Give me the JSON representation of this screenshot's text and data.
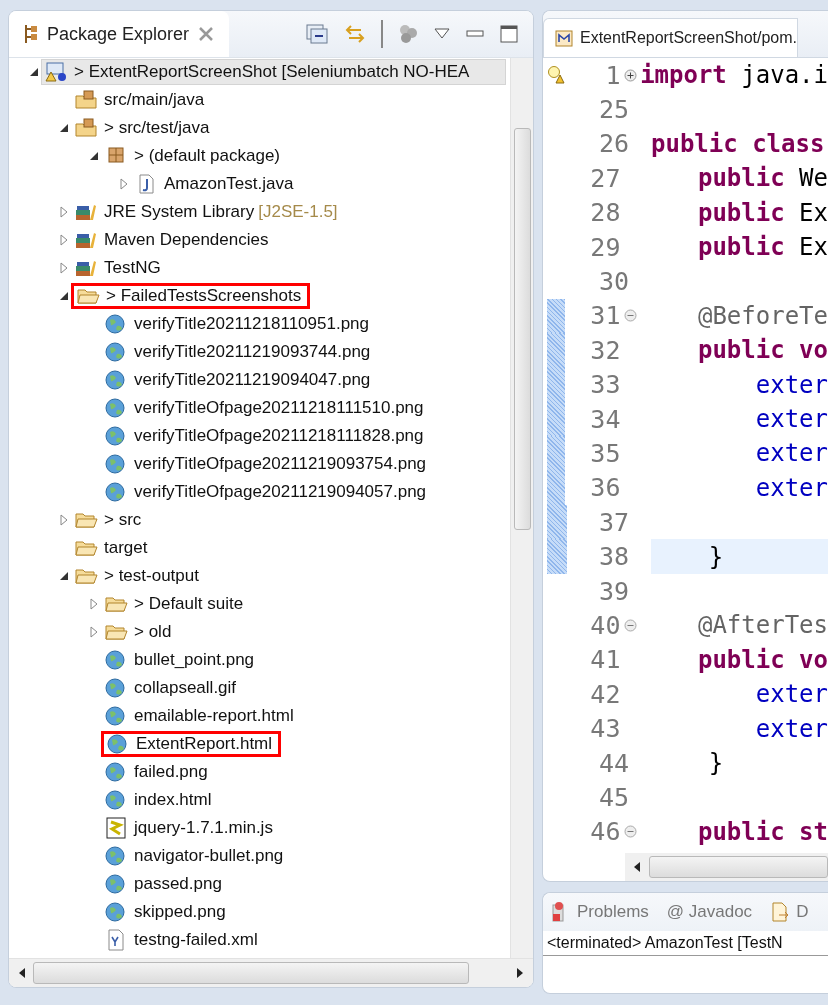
{
  "explorer": {
    "title": "Package Explorer",
    "tree": [
      {
        "kind": "project",
        "label": "> ExtentReportScreenShot [Seleniumbatch NO-HEA",
        "selected": true,
        "highlighted": false,
        "expanded": true,
        "children": [
          {
            "kind": "source-folder",
            "label": "src/main/java",
            "selected": false,
            "highlighted": false
          },
          {
            "kind": "source-folder",
            "label": "> src/test/java",
            "selected": false,
            "highlighted": false,
            "expanded": true,
            "children": [
              {
                "kind": "package",
                "label": "> (default package)",
                "selected": false,
                "highlighted": false,
                "expanded": true,
                "children": [
                  {
                    "kind": "java-file",
                    "label": "AmazonTest.java",
                    "selected": false,
                    "highlighted": false,
                    "expanded": false
                  }
                ]
              }
            ]
          },
          {
            "kind": "library",
            "label": "JRE System Library",
            "decoration": "[J2SE-1.5]",
            "selected": false,
            "highlighted": false,
            "expanded": false
          },
          {
            "kind": "library",
            "label": "Maven Dependencies",
            "selected": false,
            "highlighted": false,
            "expanded": false
          },
          {
            "kind": "library",
            "label": "TestNG",
            "selected": false,
            "highlighted": false,
            "expanded": false
          },
          {
            "kind": "folder",
            "label": "> FailedTestsScreenshots",
            "selected": false,
            "highlighted": true,
            "expanded": true,
            "children": [
              {
                "kind": "web-file",
                "label": "verifyTitle20211218110951.png",
                "selected": false,
                "highlighted": false
              },
              {
                "kind": "web-file",
                "label": "verifyTitle20211219093744.png",
                "selected": false,
                "highlighted": false
              },
              {
                "kind": "web-file",
                "label": "verifyTitle20211219094047.png",
                "selected": false,
                "highlighted": false
              },
              {
                "kind": "web-file",
                "label": "verifyTitleOfpage20211218111510.png",
                "selected": false,
                "highlighted": false
              },
              {
                "kind": "web-file",
                "label": "verifyTitleOfpage20211218111828.png",
                "selected": false,
                "highlighted": false
              },
              {
                "kind": "web-file",
                "label": "verifyTitleOfpage20211219093754.png",
                "selected": false,
                "highlighted": false
              },
              {
                "kind": "web-file",
                "label": "verifyTitleOfpage20211219094057.png",
                "selected": false,
                "highlighted": false
              }
            ]
          },
          {
            "kind": "folder",
            "label": "> src",
            "selected": false,
            "highlighted": false,
            "expanded": false
          },
          {
            "kind": "folder",
            "label": "target",
            "selected": false,
            "highlighted": false
          },
          {
            "kind": "folder",
            "label": "> test-output",
            "selected": false,
            "highlighted": false,
            "expanded": true,
            "children": [
              {
                "kind": "folder",
                "label": "> Default suite",
                "selected": false,
                "highlighted": false,
                "expanded": false
              },
              {
                "kind": "folder",
                "label": "> old",
                "selected": false,
                "highlighted": false,
                "expanded": false
              },
              {
                "kind": "web-file",
                "label": "bullet_point.png",
                "selected": false,
                "highlighted": false
              },
              {
                "kind": "web-file",
                "label": "collapseall.gif",
                "selected": false,
                "highlighted": false
              },
              {
                "kind": "web-file",
                "label": "emailable-report.html",
                "selected": false,
                "highlighted": false
              },
              {
                "kind": "web-file",
                "label": "ExtentReport.html",
                "selected": false,
                "highlighted": true
              },
              {
                "kind": "web-file",
                "label": "failed.png",
                "selected": false,
                "highlighted": false
              },
              {
                "kind": "web-file",
                "label": "index.html",
                "selected": false,
                "highlighted": false
              },
              {
                "kind": "script-file",
                "label": "jquery-1.7.1.min.js",
                "selected": false,
                "highlighted": false
              },
              {
                "kind": "web-file",
                "label": "navigator-bullet.png",
                "selected": false,
                "highlighted": false
              },
              {
                "kind": "web-file",
                "label": "passed.png",
                "selected": false,
                "highlighted": false
              },
              {
                "kind": "web-file",
                "label": "skipped.png",
                "selected": false,
                "highlighted": false
              },
              {
                "kind": "xml-file",
                "label": "testng-failed.xml",
                "selected": false,
                "highlighted": false
              }
            ]
          }
        ]
      }
    ]
  },
  "editor": {
    "tab": "ExtentReportScreenShot/pom.",
    "lines": [
      {
        "number": "1",
        "collapsed": true,
        "warning": true,
        "tokens": [
          {
            "kind": "keyword",
            "text": "import"
          },
          {
            "kind": "plain",
            "text": " java.i"
          }
        ]
      },
      {
        "number": "25"
      },
      {
        "number": "26",
        "tokens": [
          {
            "kind": "keyword",
            "text": "public class"
          }
        ]
      },
      {
        "number": "27",
        "tokens": [
          {
            "kind": "keyword",
            "text": "    public"
          },
          {
            "kind": "plain",
            "text": " We"
          }
        ]
      },
      {
        "number": "28",
        "tokens": [
          {
            "kind": "keyword",
            "text": "    public"
          },
          {
            "kind": "plain",
            "text": " Ex"
          }
        ]
      },
      {
        "number": "29",
        "tokens": [
          {
            "kind": "keyword",
            "text": "    public"
          },
          {
            "kind": "plain",
            "text": " Ex"
          }
        ]
      },
      {
        "number": "30"
      },
      {
        "number": "31",
        "collapsed": false,
        "changed": true,
        "tokens": [
          {
            "kind": "annotation",
            "text": "    @BeforeTe"
          }
        ]
      },
      {
        "number": "32",
        "changed": true,
        "tokens": [
          {
            "kind": "keyword",
            "text": "    public vo"
          }
        ]
      },
      {
        "number": "33",
        "changed": true,
        "tokens": [
          {
            "kind": "field",
            "text": "        exter"
          }
        ]
      },
      {
        "number": "34",
        "changed": true,
        "tokens": [
          {
            "kind": "field",
            "text": "        exter"
          }
        ]
      },
      {
        "number": "35",
        "changed": true,
        "tokens": [
          {
            "kind": "field",
            "text": "        exter"
          }
        ]
      },
      {
        "number": "36",
        "changed": true,
        "tokens": [
          {
            "kind": "field",
            "text": "        exter"
          }
        ]
      },
      {
        "number": "37",
        "changed": true
      },
      {
        "number": "38",
        "changed": true,
        "current": true,
        "tokens": [
          {
            "kind": "plain",
            "text": "    }"
          }
        ]
      },
      {
        "number": "39"
      },
      {
        "number": "40",
        "collapsed": false,
        "tokens": [
          {
            "kind": "annotation",
            "text": "    @AfterTes"
          }
        ]
      },
      {
        "number": "41",
        "tokens": [
          {
            "kind": "keyword",
            "text": "    public vo"
          }
        ]
      },
      {
        "number": "42",
        "tokens": [
          {
            "kind": "field",
            "text": "        exter"
          }
        ]
      },
      {
        "number": "43",
        "tokens": [
          {
            "kind": "field",
            "text": "        exter"
          }
        ]
      },
      {
        "number": "44",
        "tokens": [
          {
            "kind": "plain",
            "text": "    }"
          }
        ]
      },
      {
        "number": "45"
      },
      {
        "number": "46",
        "collapsed": false,
        "tokens": [
          {
            "kind": "keyword",
            "text": "    public st"
          }
        ]
      }
    ]
  },
  "bottom_panel": {
    "tabs": [
      {
        "kind": "problems",
        "label": "Problems",
        "selected": false
      },
      {
        "kind": "javadoc",
        "label": "@ Javadoc",
        "selected": false
      },
      {
        "kind": "declaration",
        "label": "D",
        "selected": false
      }
    ],
    "console": "<terminated> AmazonTest [TestN"
  }
}
